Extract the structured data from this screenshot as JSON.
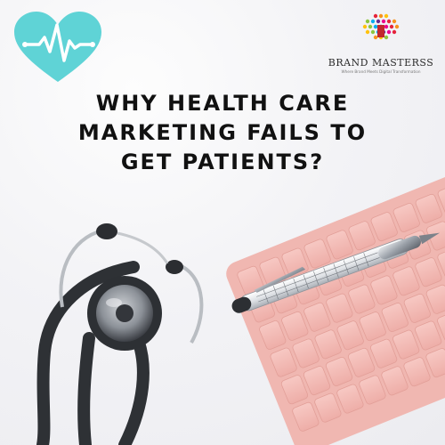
{
  "headline": {
    "line1": "WHY HEALTH CARE",
    "line2": "MARKETING FAILS TO",
    "line3": "GET PATIENTS?"
  },
  "brand": {
    "name": "BRAND MASTERSS",
    "tagline": "Where Brand Meets Digital Transformation"
  },
  "colors": {
    "heart": "#5fd3d6",
    "keyboard": "#f2b9b4",
    "background": "#f3f3f6",
    "headline_text": "#111111"
  },
  "icons": {
    "badge": "heart-pulse-icon",
    "logo": "brand-dots-icon"
  }
}
